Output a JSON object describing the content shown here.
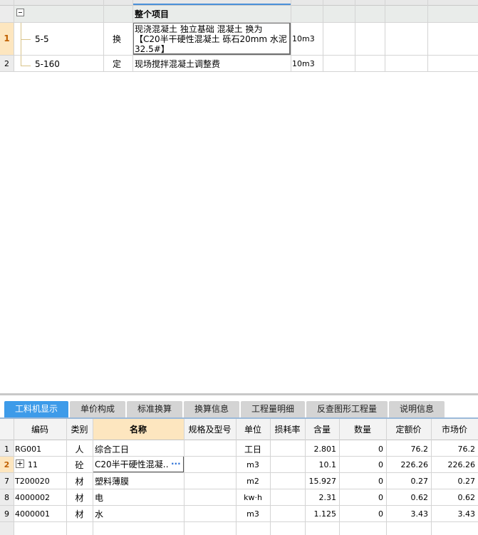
{
  "upper": {
    "group_row": {
      "name": "整个项目"
    },
    "rows": [
      {
        "num": "1",
        "code": "5-5",
        "type": "换",
        "name_lines": [
          "现浇混凝土 独立基础 混凝土  换为",
          "【C20半干硬性混凝土 砾石20mm 水泥",
          "32.5#】"
        ],
        "unit": "10m3"
      },
      {
        "num": "2",
        "code": "5-160",
        "type": "定",
        "name": "现场搅拌混凝土调整费",
        "unit": "10m3"
      }
    ]
  },
  "lower": {
    "tabs": [
      "工料机显示",
      "单价构成",
      "标准换算",
      "换算信息",
      "工程量明细",
      "反查图形工程量",
      "说明信息"
    ],
    "active_tab": "工料机显示",
    "columns": [
      "编码",
      "类别",
      "名称",
      "规格及型号",
      "单位",
      "损耗率",
      "含量",
      "数量",
      "定额价",
      "市场价"
    ],
    "rows": [
      {
        "num": "1",
        "code": "RG001",
        "type": "人",
        "name": "综合工日",
        "spec": "",
        "unit": "工日",
        "loss": "",
        "content": "2.801",
        "qty": "0",
        "quota_price": "76.2",
        "market_price": "76.2"
      },
      {
        "num": "2",
        "code": "11",
        "type": "砼",
        "name": "C20半干硬性混凝…",
        "spec": "",
        "unit": "m3",
        "loss": "",
        "content": "10.1",
        "qty": "0",
        "quota_price": "226.26",
        "market_price": "226.26",
        "expand": "+",
        "more": "···"
      },
      {
        "num": "7",
        "code": "T200020",
        "type": "材",
        "name": "塑料薄膜",
        "spec": "",
        "unit": "m2",
        "loss": "",
        "content": "15.927",
        "qty": "0",
        "quota_price": "0.27",
        "market_price": "0.27"
      },
      {
        "num": "8",
        "code": "4000002",
        "type": "材",
        "name": "电",
        "spec": "",
        "unit": "kw·h",
        "loss": "",
        "content": "2.31",
        "qty": "0",
        "quota_price": "0.62",
        "market_price": "0.62"
      },
      {
        "num": "9",
        "code": "4000001",
        "type": "材",
        "name": "水",
        "spec": "",
        "unit": "m3",
        "loss": "",
        "content": "1.125",
        "qty": "0",
        "quota_price": "3.43",
        "market_price": "3.43"
      }
    ]
  }
}
